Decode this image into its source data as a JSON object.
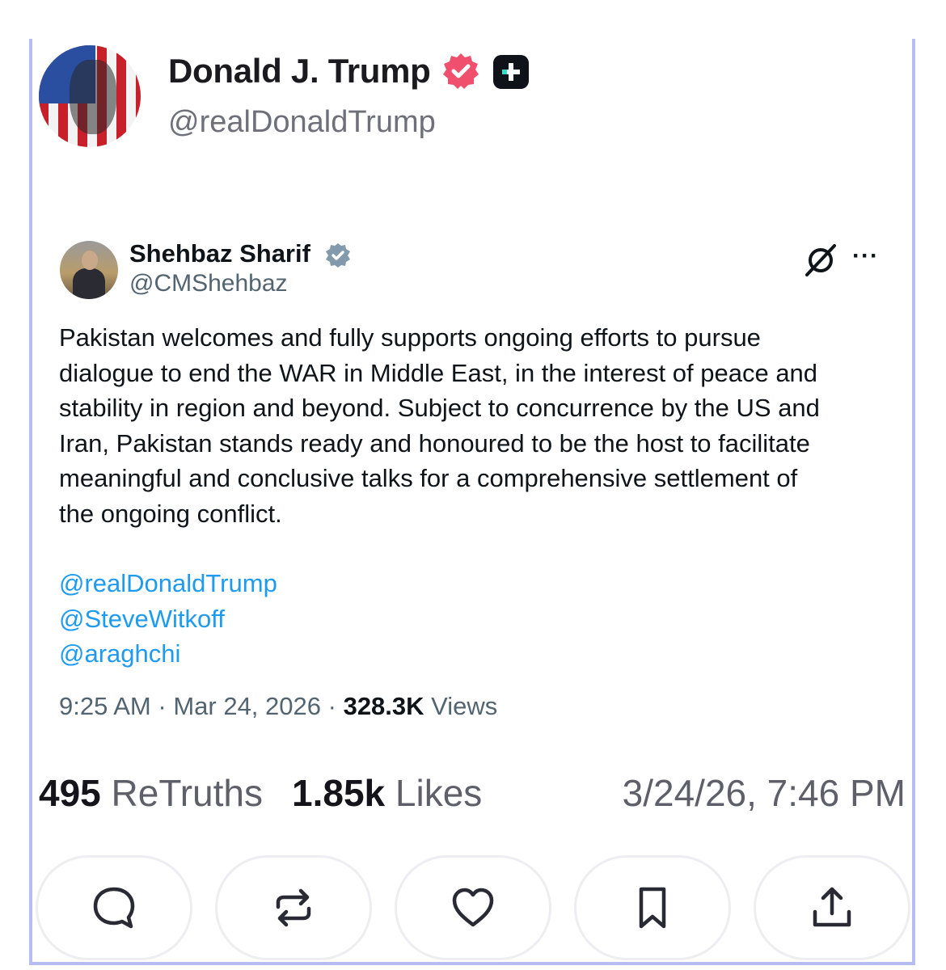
{
  "post": {
    "author_name": "Donald J. Trump",
    "author_handle": "@realDonaldTrump",
    "stats": {
      "retruths_count": "495",
      "retruths_label": "ReTruths",
      "likes_count": "1.85k",
      "likes_label": "Likes"
    },
    "timestamp": "3/24/26, 7:46 PM"
  },
  "quoted": {
    "author_name": "Shehbaz Sharif",
    "author_handle": "@CMShehbaz",
    "text_lines": [
      "Pakistan welcomes and fully supports ongoing efforts to pursue",
      "dialogue to end the WAR in Middle East, in the interest of peace and",
      "stability in region and beyond. Subject to concurrence by the US and",
      "Iran, Pakistan stands ready and honoured to be the host to facilitate",
      "meaningful and conclusive talks for a comprehensive settlement of",
      "the ongoing conflict."
    ],
    "mentions": [
      "@realDonaldTrump",
      "@SteveWitkoff",
      "@araghchi"
    ],
    "time": "9:25 AM",
    "date": "Mar 24, 2026",
    "separator": "·",
    "views_count": "328.3K",
    "views_label": "Views",
    "more_label": "···"
  },
  "actions": [
    {
      "name": "reply",
      "icon": "comment-icon"
    },
    {
      "name": "retruth",
      "icon": "repost-icon"
    },
    {
      "name": "like",
      "icon": "heart-icon"
    },
    {
      "name": "bookmark",
      "icon": "bookmark-icon"
    },
    {
      "name": "share",
      "icon": "share-icon"
    }
  ],
  "colors": {
    "frame_border": "#b7bdf0",
    "verified_badge": "#f0506e",
    "link": "#1d9bf0",
    "quoted_verified": "#829aab"
  }
}
